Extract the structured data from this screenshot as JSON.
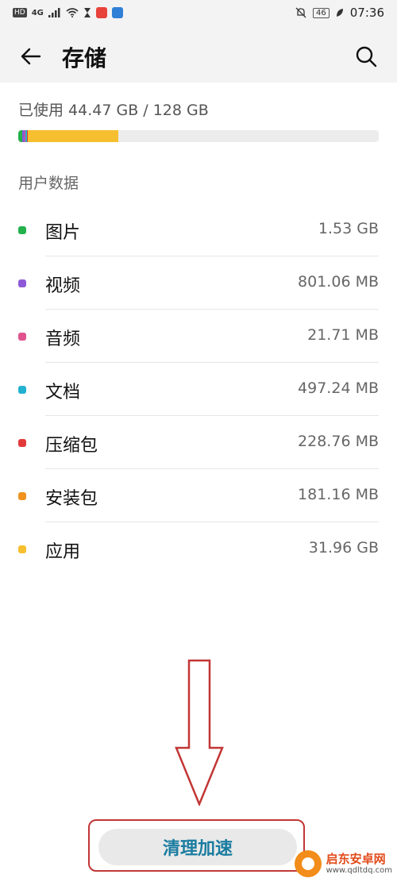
{
  "statusbar": {
    "hd": "HD",
    "net": "4G",
    "battery": "46",
    "time": "07:36"
  },
  "header": {
    "title": "存储"
  },
  "storage": {
    "used_text": "已使用 44.47 GB / 128 GB",
    "bar_segments": [
      {
        "category": "图片",
        "fraction": 0.012,
        "color": "#22b14c"
      },
      {
        "category": "视频",
        "fraction": 0.0063,
        "color": "#8e5ad8"
      },
      {
        "category": "音频",
        "fraction": 0.0018,
        "color": "#e0538e"
      },
      {
        "category": "文档",
        "fraction": 0.0039,
        "color": "#22b2d0"
      },
      {
        "category": "压缩包",
        "fraction": 0.0018,
        "color": "#e23a3a"
      },
      {
        "category": "安装包",
        "fraction": 0.0014,
        "color": "#f0921e"
      },
      {
        "category": "应用",
        "fraction": 0.25,
        "color": "#f6bf2f"
      }
    ]
  },
  "section_title": "用户数据",
  "items": [
    {
      "label": "图片",
      "size": "1.53 GB",
      "color": "#22b14c"
    },
    {
      "label": "视频",
      "size": "801.06 MB",
      "color": "#8e5ad8"
    },
    {
      "label": "音频",
      "size": "21.71 MB",
      "color": "#e0538e"
    },
    {
      "label": "文档",
      "size": "497.24 MB",
      "color": "#22b2d0"
    },
    {
      "label": "压缩包",
      "size": "228.76 MB",
      "color": "#e23a3a"
    },
    {
      "label": "安装包",
      "size": "181.16 MB",
      "color": "#f0921e"
    },
    {
      "label": "应用",
      "size": "31.96 GB",
      "color": "#f6bf2f"
    }
  ],
  "actions": {
    "clean_label": "清理加速"
  },
  "watermark": {
    "title": "启东安卓网",
    "url": "www.qdltdq.com"
  }
}
